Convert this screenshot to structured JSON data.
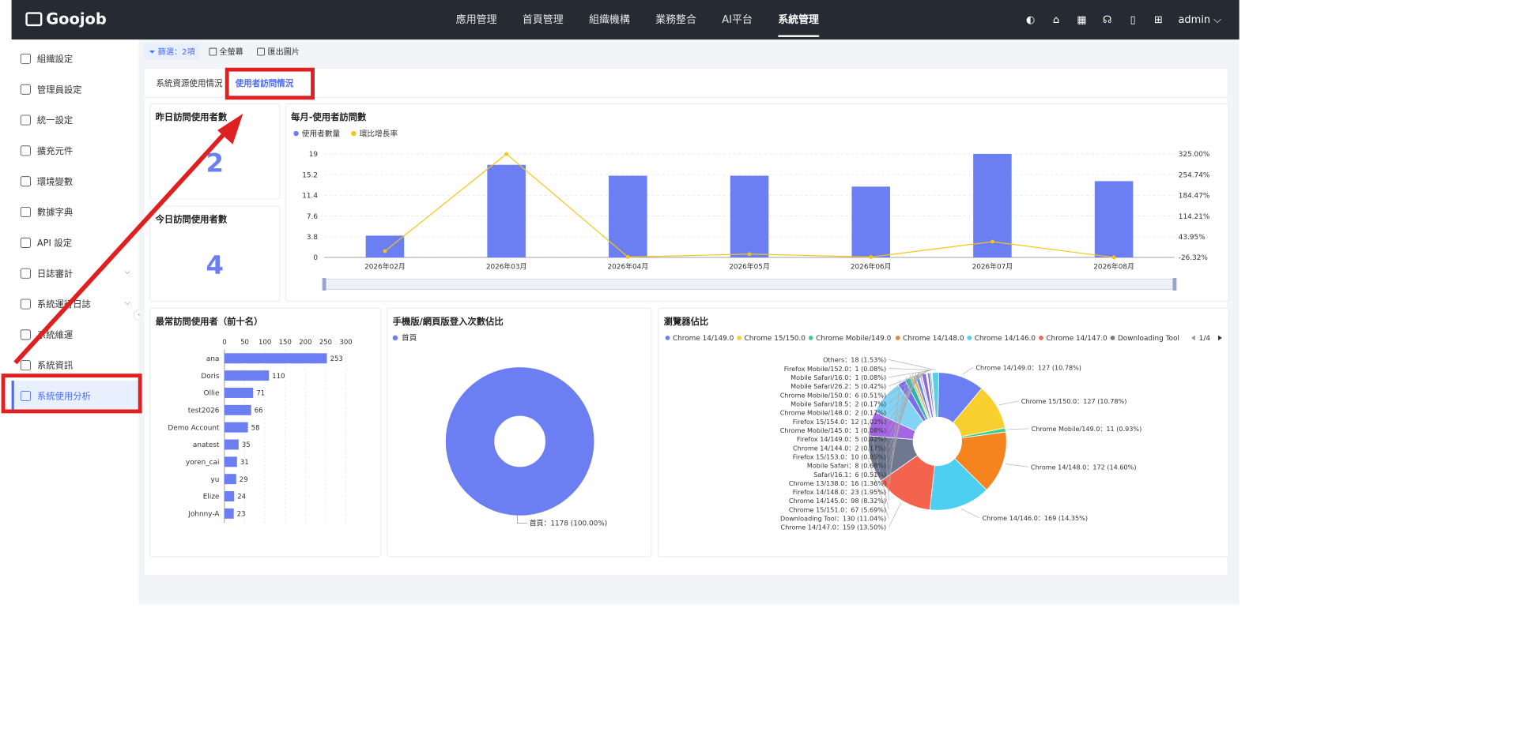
{
  "app": {
    "logo": "Goojob"
  },
  "topnav": {
    "items": [
      "應用管理",
      "首頁管理",
      "組織機構",
      "業務整合",
      "AI平台",
      "系統管理"
    ],
    "active_index": 5,
    "user": "admin"
  },
  "sidebar": {
    "items": [
      {
        "label": "組織設定",
        "icon": "gear-icon"
      },
      {
        "label": "管理員設定",
        "icon": "user-icon"
      },
      {
        "label": "統一設定",
        "icon": "cog-cluster-icon"
      },
      {
        "label": "擴充元件",
        "icon": "box-icon"
      },
      {
        "label": "環境變數",
        "icon": "terminal-icon"
      },
      {
        "label": "數據字典",
        "icon": "book-icon"
      },
      {
        "label": "API 設定",
        "icon": "api-icon"
      },
      {
        "label": "日誌審計",
        "icon": "log-icon",
        "expandable": true
      },
      {
        "label": "系統運行日誌",
        "icon": "list-icon",
        "expandable": true
      },
      {
        "label": "系統維運",
        "icon": "wrench-icon"
      },
      {
        "label": "系統資訊",
        "icon": "info-icon"
      },
      {
        "label": "系統使用分析",
        "icon": "analytics-icon",
        "active": true
      }
    ]
  },
  "toolbar": {
    "filter_label": "篩選：2項",
    "fullscreen_label": "全螢幕",
    "export_label": "匯出圖片"
  },
  "tabs": {
    "items": [
      "系統資源使用情況",
      "使用者訪問情況"
    ],
    "active_index": 1
  },
  "stats": {
    "yesterday_title": "昨日訪問使用者數",
    "yesterday_value": "2",
    "today_title": "今日訪問使用者數",
    "today_value": "4"
  },
  "colors": {
    "primary": "#6b7ff2",
    "line": "#f5c518",
    "highlight": "#e02020",
    "topbar": "#262a33"
  },
  "chart_data": [
    {
      "id": "monthly",
      "type": "bar",
      "title": "每月-使用者訪問數",
      "categories": [
        "2026年02月",
        "2026年03月",
        "2026年04月",
        "2026年05月",
        "2026年06月",
        "2026年07月",
        "2026年08月"
      ],
      "series": [
        {
          "name": "使用者數量",
          "type": "bar",
          "values": [
            4,
            17,
            15,
            15,
            13,
            19,
            14
          ]
        },
        {
          "name": "環比增長率",
          "type": "line",
          "axis": "right",
          "values": [
            -5,
            325,
            -25,
            -15,
            -25,
            27,
            -26.32
          ]
        }
      ],
      "left_ticks": [
        "19",
        "15.2",
        "11.4",
        "7.6",
        "3.8",
        "0"
      ],
      "right_ticks": [
        "325.00%",
        "254.74%",
        "184.47%",
        "114.21%",
        "43.95%",
        "-26.32%"
      ],
      "ylim": [
        0,
        19
      ],
      "y2lim": [
        -26.32,
        325
      ]
    },
    {
      "id": "top10",
      "type": "bar",
      "orientation": "horizontal",
      "title": "最常訪問使用者（前十名）",
      "categories": [
        "ana",
        "Doris",
        "Ollie",
        "test2026",
        "Demo Account",
        "anatest",
        "yoren_cai",
        "yu",
        "Elize",
        "Johnny-A"
      ],
      "values": [
        253,
        110,
        71,
        66,
        58,
        35,
        31,
        29,
        24,
        23
      ],
      "x_ticks": [
        "0",
        "50",
        "100",
        "150",
        "200",
        "250",
        "300"
      ],
      "xlim": [
        0,
        300
      ]
    },
    {
      "id": "login",
      "type": "pie",
      "title": "手機版/網頁版登入次數佔比",
      "legend": [
        "首頁"
      ],
      "slices": [
        {
          "name": "首頁",
          "value": 1178,
          "label": "首頁：1178 (100.00%)"
        }
      ]
    },
    {
      "id": "browser",
      "type": "pie",
      "title": "瀏覽器佔比",
      "legend": [
        "Chrome 14/149.0",
        "Chrome 15/150.0",
        "Chrome Mobile/149.0",
        "Chrome 14/148.0",
        "Chrome 14/146.0",
        "Chrome 14/147.0",
        "Downloading Tool"
      ],
      "legend_page": "1/4",
      "slices": [
        {
          "name": "Chrome 14/149.0",
          "value": 127,
          "label": "Chrome 14/149.0：127 (10.78%)",
          "color": "#6b7ff2"
        },
        {
          "name": "Chrome 15/150.0",
          "value": 127,
          "label": "Chrome 15/150.0：127 (10.78%)",
          "color": "#f9cf2f"
        },
        {
          "name": "Chrome Mobile/149.0",
          "value": 11,
          "label": "Chrome Mobile/149.0：11 (0.93%)",
          "color": "#3ecf8e"
        },
        {
          "name": "Chrome 14/148.0",
          "value": 172,
          "label": "Chrome 14/148.0：172 (14.60%)",
          "color": "#f5841f"
        },
        {
          "name": "Chrome 14/146.0",
          "value": 169,
          "label": "Chrome 14/146.0：169 (14.35%)",
          "color": "#4dcff2"
        },
        {
          "name": "Chrome 14/147.0",
          "value": 159,
          "label": "Chrome 14/147.0：159 (13.50%)",
          "color": "#f4634e"
        },
        {
          "name": "Downloading Tool",
          "value": 130,
          "label": "Downloading Tool：130 (11.04%)",
          "color": "#6e7891"
        },
        {
          "name": "Chrome 15/151.0",
          "value": 67,
          "label": "Chrome 15/151.0：67 (5.69%)",
          "color": "#a566e6"
        },
        {
          "name": "Chrome 14/145.0",
          "value": 98,
          "label": "Chrome 14/145.0：98 (8.32%)",
          "color": "#83d3f4"
        },
        {
          "name": "Firefox 14/148.0",
          "value": 23,
          "label": "Firefox 14/148.0：23 (1.95%)",
          "color": "#7a6cf0"
        },
        {
          "name": "Chrome 13/138.0",
          "value": 16,
          "label": "Chrome 13/138.0：16 (1.36%)",
          "color": "#2fb5a8"
        },
        {
          "name": "Safari/16.1",
          "value": 6,
          "label": "Safari/16.1：6 (0.51%)",
          "color": "#9bd67f"
        },
        {
          "name": "Mobile Safari",
          "value": 8,
          "label": "Mobile Safari：8 (0.68%)",
          "color": "#f2a65a"
        },
        {
          "name": "Firefox 15/153.0",
          "value": 10,
          "label": "Firefox 15/153.0：10 (0.85%)",
          "color": "#5b8ff9"
        },
        {
          "name": "Chrome 14/144.0",
          "value": 2,
          "label": "Chrome 14/144.0：2 (0.17%)",
          "color": "#e86a92"
        },
        {
          "name": "Firefox 14/149.0",
          "value": 5,
          "label": "Firefox 14/149.0：5 (0.42%)",
          "color": "#c2a0f0"
        },
        {
          "name": "Chrome Mobile/145.0",
          "value": 1,
          "label": "Chrome Mobile/145.0：1 (0.08%)",
          "color": "#f0c674"
        },
        {
          "name": "Firefox 15/154.0",
          "value": 12,
          "label": "Firefox 15/154.0：12 (1.02%)",
          "color": "#8c6bd9"
        },
        {
          "name": "Chrome Mobile/148.0",
          "value": 2,
          "label": "Chrome Mobile/148.0：2 (0.17%)",
          "color": "#61c2e8"
        },
        {
          "name": "Mobile Safari/18.5",
          "value": 2,
          "label": "Mobile Safari/18.5：2 (0.17%)",
          "color": "#d98c5f"
        },
        {
          "name": "Chrome Mobile/150.0",
          "value": 6,
          "label": "Chrome Mobile/150.0：6 (0.51%)",
          "color": "#4f6fd6"
        },
        {
          "name": "Mobile Safari/26.2",
          "value": 5,
          "label": "Mobile Safari/26.2：5 (0.42%)",
          "color": "#b0b7c9"
        },
        {
          "name": "Mobile Safari/16.0",
          "value": 1,
          "label": "Mobile Safari/16.0：1 (0.08%)",
          "color": "#e8d16f"
        },
        {
          "name": "Firefox Mobile/152.0",
          "value": 1,
          "label": "Firefox Mobile/152.0：1 (0.08%)",
          "color": "#8fd1c0"
        },
        {
          "name": "Others",
          "value": 18,
          "label": "Others：18 (1.53%)",
          "color": "#5ad0e6"
        }
      ]
    }
  ]
}
